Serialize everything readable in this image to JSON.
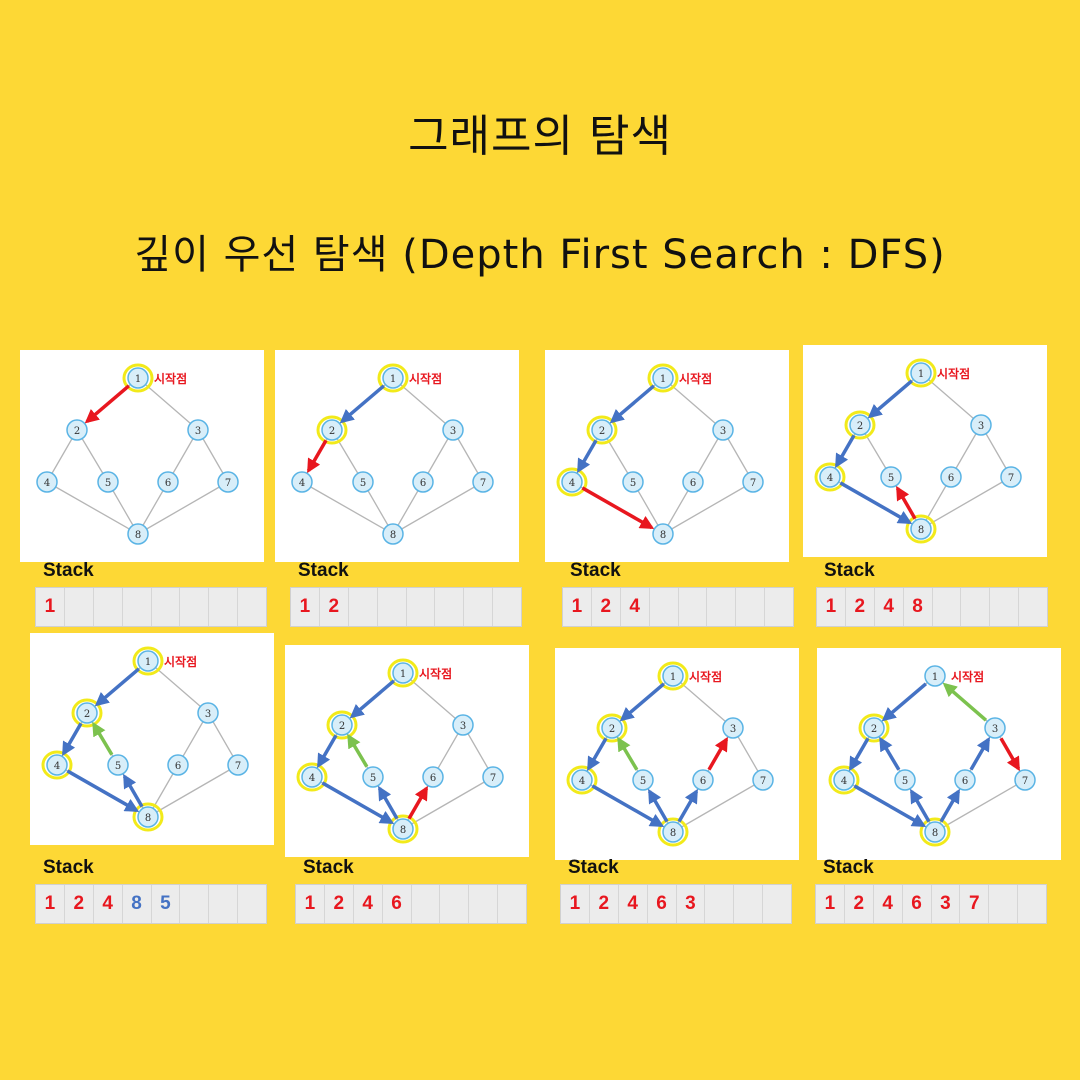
{
  "title": "그래프의 탐색",
  "subtitle": "깊이 우선 탐색 (Depth First Search : DFS)",
  "start_label": "시작점",
  "stack_label": "Stack",
  "colors": {
    "background": "#FDD835",
    "visit_edge": "#4472C4",
    "current_edge": "#E8171F",
    "backtrack_edge": "#7CC24E",
    "node_fill": "#D8EEF9",
    "node_stroke": "#5AB4E5",
    "highlight": "#F2EA1A",
    "stack_red": "#E8171F",
    "stack_blue": "#4472C4"
  },
  "nodes": [
    "1",
    "2",
    "3",
    "4",
    "5",
    "6",
    "7",
    "8"
  ],
  "edges": [
    [
      "1",
      "2"
    ],
    [
      "1",
      "3"
    ],
    [
      "2",
      "4"
    ],
    [
      "2",
      "5"
    ],
    [
      "3",
      "6"
    ],
    [
      "3",
      "7"
    ],
    [
      "4",
      "8"
    ],
    [
      "5",
      "8"
    ],
    [
      "6",
      "8"
    ],
    [
      "7",
      "8"
    ]
  ],
  "steps": [
    {
      "highlight": [
        "1"
      ],
      "arrows": [
        {
          "from": "1",
          "to": "2",
          "color": "current_edge"
        }
      ],
      "stack": [
        {
          "value": "1",
          "color": "stack_red"
        }
      ]
    },
    {
      "highlight": [
        "1",
        "2"
      ],
      "arrows": [
        {
          "from": "1",
          "to": "2",
          "color": "visit_edge"
        },
        {
          "from": "2",
          "to": "4",
          "color": "current_edge"
        }
      ],
      "stack": [
        {
          "value": "1",
          "color": "stack_red"
        },
        {
          "value": "2",
          "color": "stack_red"
        }
      ]
    },
    {
      "highlight": [
        "1",
        "2",
        "4"
      ],
      "arrows": [
        {
          "from": "1",
          "to": "2",
          "color": "visit_edge"
        },
        {
          "from": "2",
          "to": "4",
          "color": "visit_edge"
        },
        {
          "from": "4",
          "to": "8",
          "color": "current_edge"
        }
      ],
      "stack": [
        {
          "value": "1",
          "color": "stack_red"
        },
        {
          "value": "2",
          "color": "stack_red"
        },
        {
          "value": "4",
          "color": "stack_red"
        }
      ]
    },
    {
      "highlight": [
        "1",
        "2",
        "4",
        "8"
      ],
      "arrows": [
        {
          "from": "1",
          "to": "2",
          "color": "visit_edge"
        },
        {
          "from": "2",
          "to": "4",
          "color": "visit_edge"
        },
        {
          "from": "4",
          "to": "8",
          "color": "visit_edge"
        },
        {
          "from": "8",
          "to": "5",
          "color": "current_edge"
        }
      ],
      "stack": [
        {
          "value": "1",
          "color": "stack_red"
        },
        {
          "value": "2",
          "color": "stack_red"
        },
        {
          "value": "4",
          "color": "stack_red"
        },
        {
          "value": "8",
          "color": "stack_red"
        }
      ]
    },
    {
      "highlight": [
        "1",
        "2",
        "4",
        "8"
      ],
      "arrows": [
        {
          "from": "1",
          "to": "2",
          "color": "visit_edge"
        },
        {
          "from": "2",
          "to": "4",
          "color": "visit_edge"
        },
        {
          "from": "4",
          "to": "8",
          "color": "visit_edge"
        },
        {
          "from": "8",
          "to": "5",
          "color": "visit_edge"
        },
        {
          "from": "5",
          "to": "2",
          "color": "backtrack_edge"
        }
      ],
      "stack": [
        {
          "value": "1",
          "color": "stack_red"
        },
        {
          "value": "2",
          "color": "stack_red"
        },
        {
          "value": "4",
          "color": "stack_red"
        },
        {
          "value": "8",
          "color": "stack_blue"
        },
        {
          "value": "5",
          "color": "stack_blue"
        }
      ]
    },
    {
      "highlight": [
        "1",
        "2",
        "4",
        "8"
      ],
      "arrows": [
        {
          "from": "1",
          "to": "2",
          "color": "visit_edge"
        },
        {
          "from": "2",
          "to": "4",
          "color": "visit_edge"
        },
        {
          "from": "4",
          "to": "8",
          "color": "visit_edge"
        },
        {
          "from": "8",
          "to": "5",
          "color": "visit_edge"
        },
        {
          "from": "5",
          "to": "2",
          "color": "backtrack_edge"
        },
        {
          "from": "8",
          "to": "6",
          "color": "current_edge"
        }
      ],
      "stack": [
        {
          "value": "1",
          "color": "stack_red"
        },
        {
          "value": "2",
          "color": "stack_red"
        },
        {
          "value": "4",
          "color": "stack_red"
        },
        {
          "value": "6",
          "color": "stack_red"
        }
      ]
    },
    {
      "highlight": [
        "1",
        "2",
        "4",
        "8"
      ],
      "arrows": [
        {
          "from": "1",
          "to": "2",
          "color": "visit_edge"
        },
        {
          "from": "2",
          "to": "4",
          "color": "visit_edge"
        },
        {
          "from": "4",
          "to": "8",
          "color": "visit_edge"
        },
        {
          "from": "8",
          "to": "5",
          "color": "visit_edge"
        },
        {
          "from": "5",
          "to": "2",
          "color": "backtrack_edge"
        },
        {
          "from": "8",
          "to": "6",
          "color": "visit_edge"
        },
        {
          "from": "6",
          "to": "3",
          "color": "current_edge"
        }
      ],
      "stack": [
        {
          "value": "1",
          "color": "stack_red"
        },
        {
          "value": "2",
          "color": "stack_red"
        },
        {
          "value": "4",
          "color": "stack_red"
        },
        {
          "value": "6",
          "color": "stack_red"
        },
        {
          "value": "3",
          "color": "stack_red"
        }
      ]
    },
    {
      "highlight": [
        "2",
        "4",
        "8"
      ],
      "arrows": [
        {
          "from": "3",
          "to": "1",
          "color": "backtrack_edge"
        },
        {
          "from": "1",
          "to": "2",
          "color": "visit_edge"
        },
        {
          "from": "2",
          "to": "4",
          "color": "visit_edge"
        },
        {
          "from": "4",
          "to": "8",
          "color": "visit_edge"
        },
        {
          "from": "8",
          "to": "5",
          "color": "visit_edge"
        },
        {
          "from": "5",
          "to": "2",
          "color": "visit_edge"
        },
        {
          "from": "8",
          "to": "6",
          "color": "visit_edge"
        },
        {
          "from": "6",
          "to": "3",
          "color": "visit_edge"
        },
        {
          "from": "3",
          "to": "7",
          "color": "current_edge"
        }
      ],
      "stack": [
        {
          "value": "1",
          "color": "stack_red"
        },
        {
          "value": "2",
          "color": "stack_red"
        },
        {
          "value": "4",
          "color": "stack_red"
        },
        {
          "value": "6",
          "color": "stack_red"
        },
        {
          "value": "3",
          "color": "stack_red"
        },
        {
          "value": "7",
          "color": "stack_red"
        }
      ]
    }
  ]
}
